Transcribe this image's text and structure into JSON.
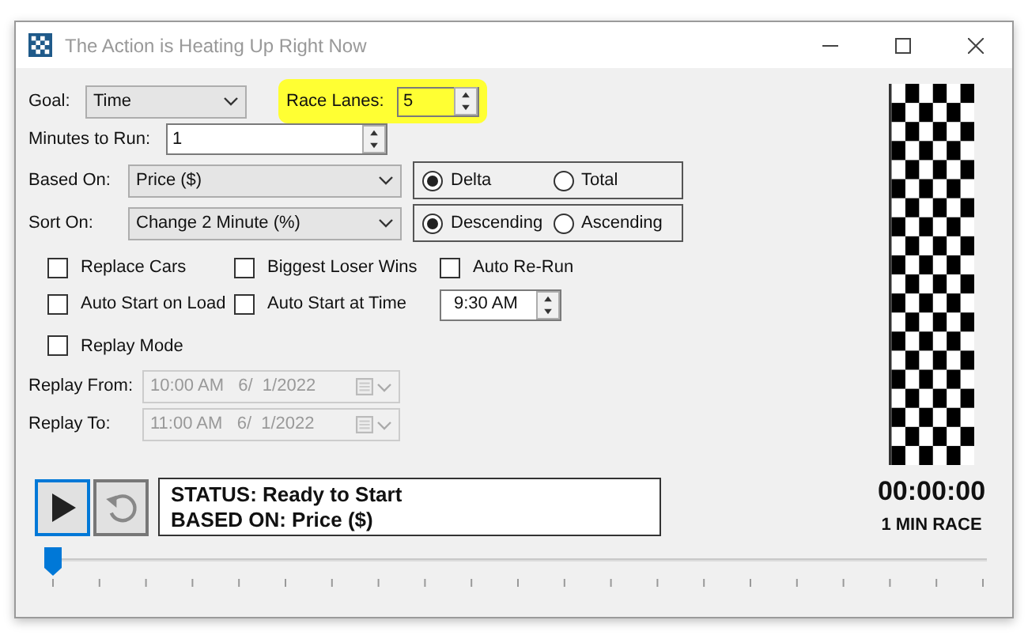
{
  "window": {
    "title": "The Action is Heating Up Right Now"
  },
  "goal": {
    "label": "Goal:",
    "value": "Time"
  },
  "race_lanes": {
    "label": "Race Lanes:",
    "value": "5",
    "highlighted": true
  },
  "minutes_to_run": {
    "label": "Minutes to Run:",
    "value": "1"
  },
  "based_on": {
    "label": "Based On:",
    "value": "Price ($)",
    "options": [
      {
        "label": "Delta",
        "selected": true
      },
      {
        "label": "Total",
        "selected": false
      }
    ]
  },
  "sort_on": {
    "label": "Sort On:",
    "value": "Change 2 Minute (%)",
    "options": [
      {
        "label": "Descending",
        "selected": true
      },
      {
        "label": "Ascending",
        "selected": false
      }
    ]
  },
  "checkboxes": [
    {
      "label": "Replace Cars",
      "checked": false
    },
    {
      "label": "Biggest Loser Wins",
      "checked": false
    },
    {
      "label": "Auto Re-Run",
      "checked": false
    },
    {
      "label": "Auto Start on Load",
      "checked": false
    },
    {
      "label": "Auto Start at Time",
      "checked": false
    }
  ],
  "start_time": {
    "value": "9:30 AM"
  },
  "replay_mode": {
    "label": "Replay Mode",
    "checked": false
  },
  "replay_from": {
    "label": "Replay From:",
    "value": "10:00 AM   6/  1/2022",
    "disabled": true
  },
  "replay_to": {
    "label": "Replay To:",
    "value": "11:00 AM   6/  1/2022",
    "disabled": true
  },
  "status": {
    "lines": [
      "STATUS: Ready to Start",
      "BASED ON: Price ($)"
    ]
  },
  "timer": {
    "time": "00:00:00",
    "caption": "1 MIN RACE"
  },
  "progress_slider": {
    "level": 0
  }
}
